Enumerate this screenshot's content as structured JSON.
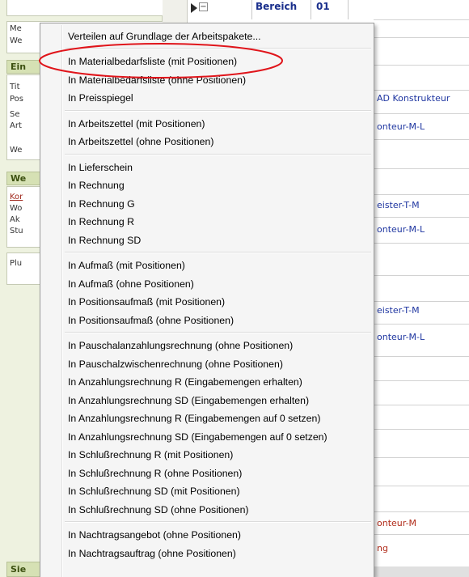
{
  "header": {
    "col_bereich": "Bereich",
    "col_num": "01"
  },
  "sidebar": {
    "truncated": [
      "Me",
      "We",
      "Tit",
      "Pos",
      "Se",
      "Art",
      "We",
      "Wo",
      "Ak",
      "Stu",
      "Plu"
    ],
    "headers": [
      "Ein",
      "We",
      "Sie"
    ],
    "link": "Kor"
  },
  "grid_right": [
    {
      "text": "AD Konstrukteur",
      "color": "blue"
    },
    {
      "text": "onteur-M-L",
      "color": "blue"
    },
    {
      "text": "eister-T-M",
      "color": "blue"
    },
    {
      "text": "onteur-M-L",
      "color": "blue"
    },
    {
      "text": "eister-T-M",
      "color": "blue"
    },
    {
      "text": "onteur-M-L",
      "color": "blue"
    },
    {
      "text": "onteur-M",
      "color": "red"
    },
    {
      "text": "ng",
      "color": "red"
    }
  ],
  "menu": {
    "groups": [
      [
        "Verteilen auf Grundlage der Arbeitspakete..."
      ],
      [
        "In Materialbedarfsliste (mit Positionen)",
        "In Materialbedarfsliste (ohne Positionen)",
        "In Preisspiegel"
      ],
      [
        "In Arbeitszettel (mit Positionen)",
        "In Arbeitszettel (ohne Positionen)"
      ],
      [
        "In Lieferschein",
        "In Rechnung",
        "In Rechnung G",
        "In Rechnung R",
        "In Rechnung SD"
      ],
      [
        "In Aufmaß (mit Positionen)",
        "In Aufmaß (ohne Positionen)",
        "In Positionsaufmaß (mit Positionen)",
        "In Positionsaufmaß (ohne Positionen)"
      ],
      [
        "In Pauschalanzahlungsrechnung (ohne Positionen)",
        "In Pauschalzwischenrechnung (ohne Positionen)",
        "In Anzahlungsrechnung R (Eingabemengen erhalten)",
        "In Anzahlungsrechnung SD (Eingabemengen erhalten)",
        "In Anzahlungsrechnung R (Eingabemengen auf 0 setzen)",
        "In Anzahlungsrechnung SD (Eingabemengen auf 0 setzen)",
        "In Schlußrechnung R (mit Positionen)",
        "In Schlußrechnung R (ohne Positionen)",
        "In Schlußrechnung SD (mit Positionen)",
        "In Schlußrechnung SD (ohne Positionen)"
      ],
      [
        "In Nachtragsangebot (ohne Positionen)",
        "In Nachtragsauftrag (ohne Positionen)"
      ]
    ]
  },
  "colors": {
    "annotation": "#e0151b",
    "link_blue": "#1e35a0",
    "link_red": "#b02a18",
    "sidebar_header": "#d6e1b4"
  }
}
